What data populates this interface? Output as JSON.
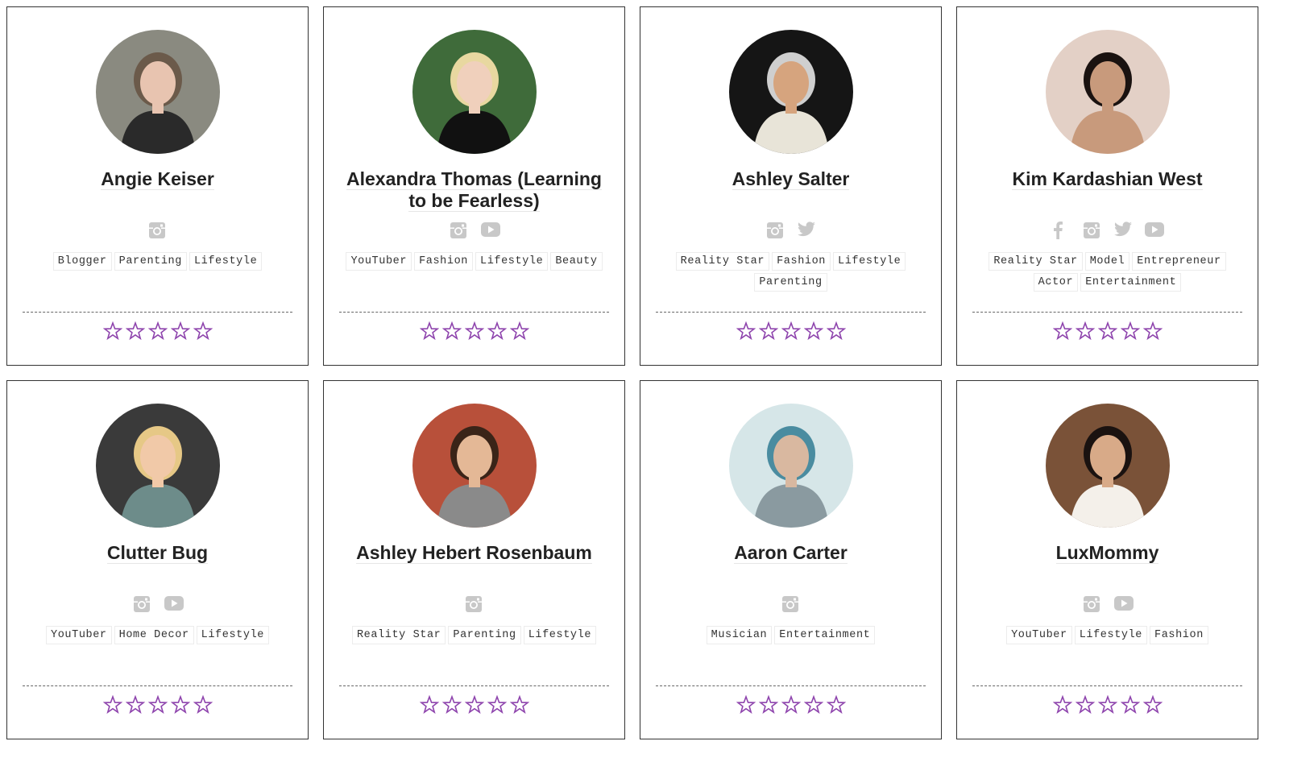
{
  "colors": {
    "star": "#8e44ad",
    "icon": "#c8c8c8",
    "border": "#333333",
    "name": "#222222"
  },
  "influencers": [
    {
      "name": "Angie Keiser",
      "socials": [
        "instagram-icon"
      ],
      "tags": [
        "Blogger",
        "Parenting",
        "Lifestyle"
      ],
      "rating": 0,
      "avatar": {
        "bg": "#8a8a80",
        "skin": "#e8c4b0",
        "hair": "#6b5a4a",
        "cloth": "#2a2a2a"
      }
    },
    {
      "name": "Alexandra Thomas (Learning to be Fearless)",
      "socials": [
        "instagram-icon",
        "youtube-icon"
      ],
      "tags": [
        "YouTuber",
        "Fashion",
        "Lifestyle",
        "Beauty"
      ],
      "rating": 0,
      "avatar": {
        "bg": "#3f6b3a",
        "skin": "#f0d0bc",
        "hair": "#e8d8a0",
        "cloth": "#111111"
      }
    },
    {
      "name": "Ashley Salter",
      "socials": [
        "instagram-icon",
        "twitter-icon"
      ],
      "tags": [
        "Reality Star",
        "Fashion",
        "Lifestyle",
        "Parenting"
      ],
      "rating": 0,
      "avatar": {
        "bg": "#151515",
        "skin": "#d6a47e",
        "hair": "#cfcfcf",
        "cloth": "#e8e4d8"
      }
    },
    {
      "name": "Kim Kardashian West",
      "socials": [
        "facebook-icon",
        "instagram-icon",
        "twitter-icon",
        "youtube-icon"
      ],
      "tags": [
        "Reality Star",
        "Model",
        "Entrepreneur",
        "Actor",
        "Entertainment"
      ],
      "rating": 0,
      "avatar": {
        "bg": "#e3d0c6",
        "skin": "#c89a7c",
        "hair": "#1a1210",
        "cloth": "#c89a7c"
      }
    },
    {
      "name": "Clutter Bug",
      "socials": [
        "instagram-icon",
        "youtube-icon"
      ],
      "tags": [
        "YouTuber",
        "Home Decor",
        "Lifestyle"
      ],
      "rating": 0,
      "avatar": {
        "bg": "#3a3a3a",
        "skin": "#f1c9a8",
        "hair": "#e6c886",
        "cloth": "#6d8c8a"
      }
    },
    {
      "name": "Ashley Hebert Rosenbaum",
      "socials": [
        "instagram-icon"
      ],
      "tags": [
        "Reality Star",
        "Parenting",
        "Lifestyle"
      ],
      "rating": 0,
      "avatar": {
        "bg": "#b8503a",
        "skin": "#e4b896",
        "hair": "#3a2418",
        "cloth": "#8a8a8a"
      }
    },
    {
      "name": "Aaron Carter",
      "socials": [
        "instagram-icon"
      ],
      "tags": [
        "Musician",
        "Entertainment"
      ],
      "rating": 0,
      "avatar": {
        "bg": "#d6e6e8",
        "skin": "#d9b8a0",
        "hair": "#4a8ca0",
        "cloth": "#8a9aa0"
      }
    },
    {
      "name": "LuxMommy",
      "socials": [
        "instagram-icon",
        "youtube-icon"
      ],
      "tags": [
        "YouTuber",
        "Lifestyle",
        "Fashion"
      ],
      "rating": 0,
      "avatar": {
        "bg": "#7a5238",
        "skin": "#d8aa88",
        "hair": "#1a1210",
        "cloth": "#f4f0ea"
      }
    }
  ]
}
